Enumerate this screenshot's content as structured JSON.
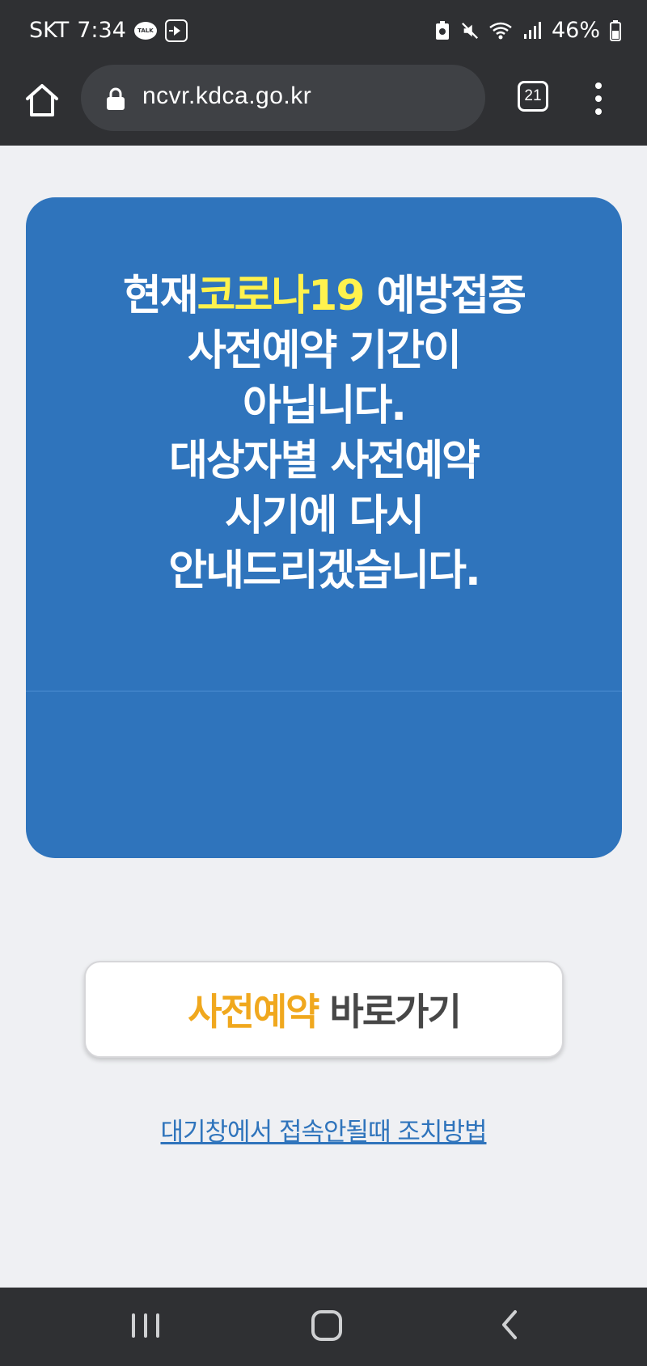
{
  "status_bar": {
    "carrier": "SKT",
    "time": "7:34",
    "battery": "46%"
  },
  "browser": {
    "url": "ncvr.kdca.go.kr",
    "tab_count": "21"
  },
  "notice": {
    "prefix": "현재",
    "highlight": "코로나19",
    "line1_rest": " 예방접종",
    "line2": "사전예약 기간이",
    "line3": "아닙니다.",
    "line4": "대상자별 사전예약",
    "line5": "시기에 다시",
    "line6": "안내드리겠습니다."
  },
  "reserve_button": {
    "accent": "사전예약",
    "rest": "바로가기"
  },
  "help_link": "대기창에서 접속안될때 조치방법",
  "colors": {
    "card_blue": "#2f74bc",
    "highlight_yellow": "#fff24d",
    "button_accent": "#f0a81e",
    "chrome_dark": "#2f3033"
  }
}
